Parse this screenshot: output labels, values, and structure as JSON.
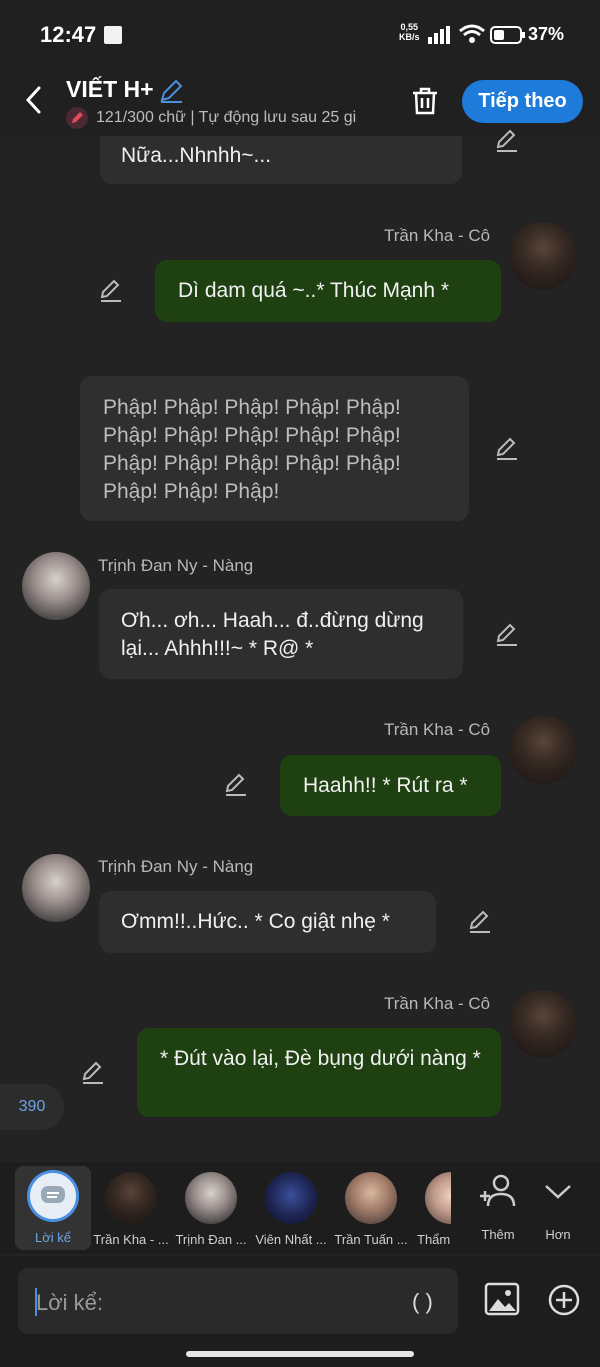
{
  "status_bar": {
    "time": "12:47",
    "net_speed_top": "0,55",
    "net_speed_bottom": "KB/s",
    "battery": "37%"
  },
  "header": {
    "title": "VIẾT H+",
    "subtitle": "121/300 chữ | Tự động lưu sau 25 gi",
    "next_button": "Tiếp theo"
  },
  "messages": {
    "partial_top": "Nữa...Nhnhh~...",
    "m1_name": "Trần Kha - Cô",
    "m1_text": "Dì dam quá ~..* Thúc Mạnh *",
    "narration": "Phập! Phập! Phập! Phập! Phập! Phập! Phập! Phập! Phập! Phập! Phập! Phập! Phập! Phập! Phập! Phập! Phập! Phập!",
    "m2_name": "Trịnh Đan Ny - Nàng",
    "m2_text": "Ơh... ơh... Haah... đ..đừng dừng lại... Ahhh!!!~ * R@ *",
    "m3_name": "Trần Kha - Cô",
    "m3_text": "Haahh!! * Rút ra *",
    "m4_name": "Trịnh Đan Ny - Nàng",
    "m4_text": "Ơmm!!..Hức.. * Co giật nhẹ *",
    "m5_name": "Trần Kha - Cô",
    "m5_text": "* Đút vào lại, Đè bụng dưới nàng *"
  },
  "counter": "390",
  "characters": [
    {
      "label": "Lời kể",
      "icon": "chat-bubble-icon"
    },
    {
      "label": "Trần Kha - ..."
    },
    {
      "label": "Trịnh Đan ..."
    },
    {
      "label": "Viên Nhất ..."
    },
    {
      "label": "Trần Tuấn ..."
    },
    {
      "label": "Thẩm"
    }
  ],
  "actions": {
    "add_label": "Thêm",
    "more_label": "Hơn"
  },
  "input": {
    "placeholder": "Lời kể:",
    "paren": "( )"
  },
  "colors": {
    "accent": "#1e7bd9",
    "right_bubble": "#1f4011",
    "left_bubble": "#2e2e2e",
    "background": "#232323"
  }
}
